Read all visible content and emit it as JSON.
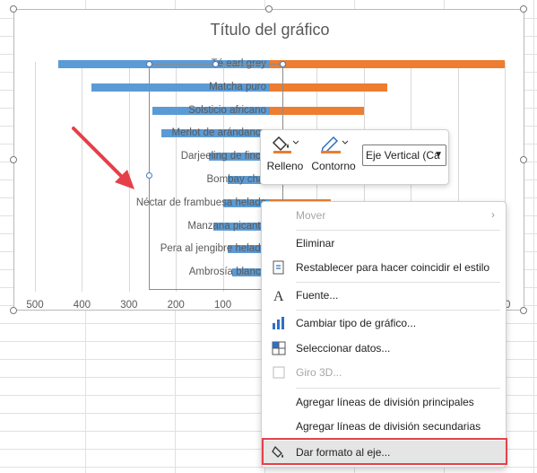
{
  "chart": {
    "title": "Título del gráfico",
    "categories": [
      "Té earl grey",
      "Matcha puro",
      "Solsticio africano",
      "Merlot de arándanos",
      "Darjeeling de finca",
      "Bombay chai",
      "Néctar de frambuesa helada",
      "Manzana picante",
      "Pera al jengibre helada",
      "Ambrosía blanca"
    ],
    "x_ticks": [
      "500",
      "400",
      "300",
      "200",
      "100",
      "00"
    ]
  },
  "chart_data": {
    "type": "bar",
    "title": "Título del gráfico",
    "categories": [
      "Té earl grey",
      "Matcha puro",
      "Solsticio africano",
      "Merlot de arándanos",
      "Darjeeling de finca",
      "Bombay chai",
      "Néctar de frambuesa helada",
      "Manzana picante",
      "Pera al jengibre helada",
      "Ambrosía blanca"
    ],
    "series": [
      {
        "color": "#5b9bd5",
        "values": [
          450,
          380,
          250,
          230,
          130,
          90,
          100,
          120,
          90,
          80
        ]
      },
      {
        "color": "#ed7d31",
        "values": [
          500,
          250,
          200,
          180,
          150,
          140,
          130,
          120,
          100,
          90
        ]
      }
    ],
    "xlim": [
      -500,
      500
    ],
    "grid": true
  },
  "toolbar": {
    "fill_label": "Relleno",
    "outline_label": "Contorno",
    "element_select": "Eje Vertical (Ca",
    "fill_color": "#ed7d31",
    "outline_color": "#ed7d31"
  },
  "menu": {
    "items": [
      {
        "label": "Mover",
        "disabled": true,
        "icon": "none",
        "submenu": true
      },
      {
        "label": "Eliminar",
        "icon": "none"
      },
      {
        "label": "Restablecer para hacer coincidir el estilo",
        "icon": "reset-style-icon"
      },
      {
        "label": "Fuente...",
        "icon": "font-icon"
      },
      {
        "label": "Cambiar tipo de gráfico...",
        "icon": "chart-type-icon"
      },
      {
        "label": "Seleccionar datos...",
        "icon": "select-data-icon"
      },
      {
        "label": "Giro 3D...",
        "disabled": true,
        "icon": "rotation-3d-icon"
      },
      {
        "label": "Agregar líneas de división principales",
        "icon": "none"
      },
      {
        "label": "Agregar líneas de división secundarias",
        "icon": "none"
      },
      {
        "label": "Dar formato al eje...",
        "icon": "format-axis-icon"
      }
    ]
  }
}
